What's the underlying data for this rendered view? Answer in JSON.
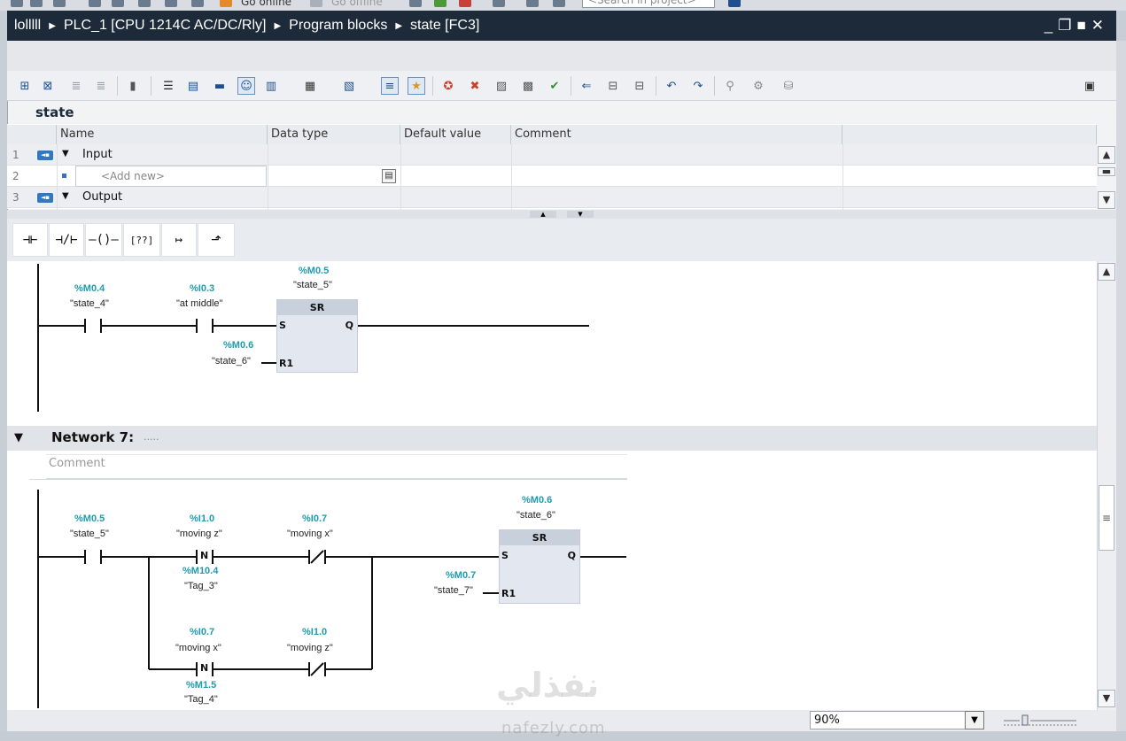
{
  "app_toolbar": {
    "go_online": "Go online",
    "go_offline": "Go offline",
    "search_placeholder": "<Search in project>"
  },
  "breadcrumb": {
    "project": "lolllll",
    "device": "PLC_1 [CPU 1214C AC/DC/Rly]",
    "folder": "Program blocks",
    "block": "state [FC3]"
  },
  "window_controls": {
    "minimize": "_",
    "restore": "❐",
    "maximize": "■",
    "close": "✕"
  },
  "block_title": "state",
  "interface_table": {
    "columns": [
      "Name",
      "Data type",
      "Default value",
      "Comment"
    ],
    "rows": [
      {
        "num": "1",
        "icon": "interface-section-icon",
        "label": "Input",
        "expanded": true
      },
      {
        "num": "2",
        "icon": "add-new-bullet-icon",
        "label": "<Add new>",
        "expanded": false
      },
      {
        "num": "3",
        "icon": "interface-section-icon",
        "label": "Output",
        "expanded": true
      }
    ]
  },
  "ladder_palette": {
    "items": [
      {
        "name": "normally-open-contact",
        "glyph": "⊣⊢"
      },
      {
        "name": "normally-closed-contact",
        "glyph": "⊣/⊢"
      },
      {
        "name": "output-coil",
        "glyph": "–()–"
      },
      {
        "name": "empty-box",
        "glyph": "[??]"
      },
      {
        "name": "open-branch",
        "glyph": "↦"
      },
      {
        "name": "close-branch",
        "glyph": "⬏"
      }
    ]
  },
  "network6": {
    "contact1": {
      "address": "%M0.4",
      "symbol": "\"state_4\""
    },
    "contact2": {
      "address": "%I0.3",
      "symbol": "\"at middle\""
    },
    "sr_block": {
      "address": "%M0.5",
      "symbol": "\"state_5\"",
      "title": "SR",
      "pin_s": "S",
      "pin_q": "Q",
      "pin_r1": "R1"
    },
    "reset": {
      "address": "%M0.6",
      "symbol": "\"state_6\""
    }
  },
  "network7": {
    "title": "Network 7:",
    "title_dots": ".....",
    "comment_placeholder": "Comment",
    "contact1": {
      "address": "%M0.5",
      "symbol": "\"state_5\""
    },
    "edge1": {
      "address": "%I1.0",
      "symbol": "\"moving z\"",
      "glyph": "N",
      "mem_address": "%M10.4",
      "mem_symbol": "\"Tag_3\""
    },
    "contact_nc1": {
      "address": "%I0.7",
      "symbol": "\"moving x\""
    },
    "edge2": {
      "address": "%I0.7",
      "symbol": "\"moving x\"",
      "glyph": "N",
      "mem_address": "%M1.5",
      "mem_symbol": "\"Tag_4\""
    },
    "contact_nc2": {
      "address": "%I1.0",
      "symbol": "\"moving z\""
    },
    "sr_block": {
      "address": "%M0.6",
      "symbol": "\"state_6\"",
      "title": "SR",
      "pin_s": "S",
      "pin_q": "Q",
      "pin_r1": "R1"
    },
    "reset": {
      "address": "%M0.7",
      "symbol": "\"state_7\""
    }
  },
  "zoom": {
    "value": "90%"
  },
  "watermark": {
    "arabic": "نفذلي",
    "latin": "nafezly.com"
  },
  "colors": {
    "title_bar": "#1d2a3a",
    "address_teal": "#1e9bad",
    "sr_header": "#c8d0dc",
    "network_bar": "#e0e3e7"
  }
}
